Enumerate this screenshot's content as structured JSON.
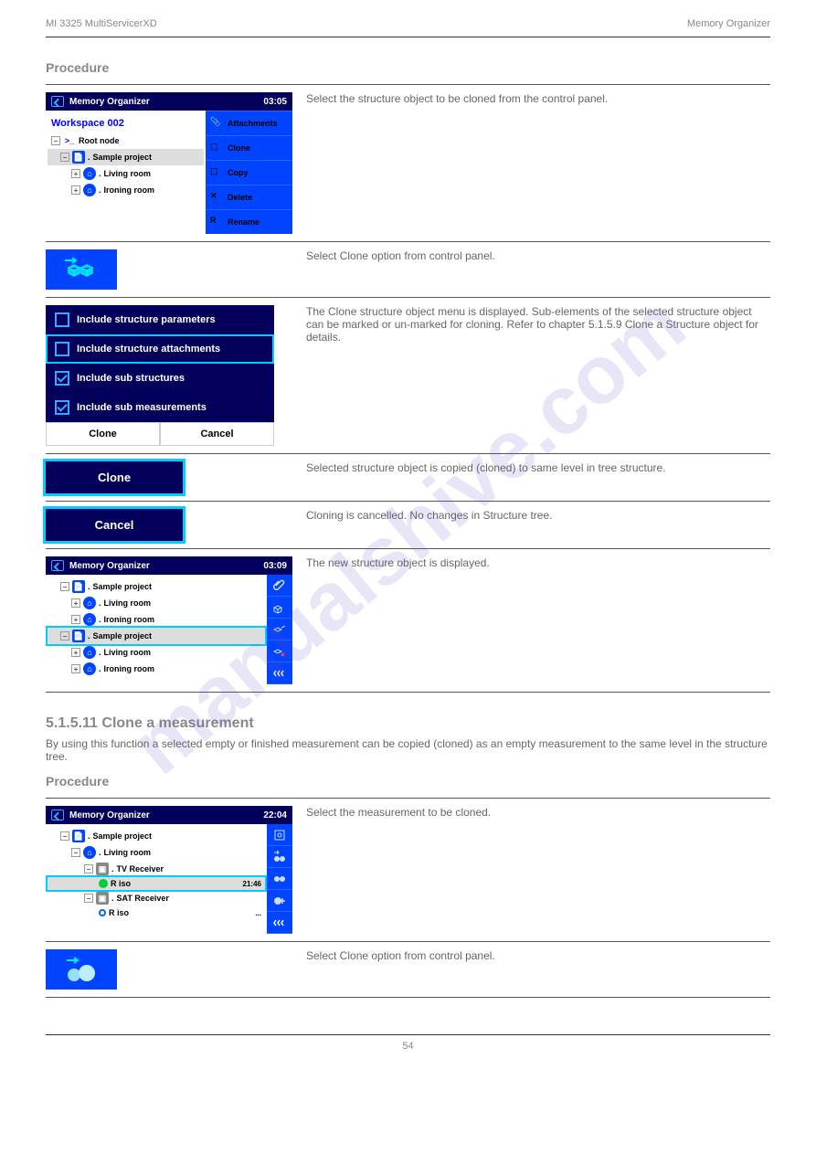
{
  "header": {
    "left": "MI 3325 MultiServicerXD",
    "right": "Memory Organizer"
  },
  "watermark": "manualshive.com",
  "proc_label": "Procedure",
  "rows": {
    "r1": {
      "screen": {
        "title": "Memory Organizer",
        "time": "03:05",
        "workspace": "Workspace 002",
        "tree": [
          "Root node",
          "Sample project",
          "Living room",
          "Ironing room"
        ],
        "menu": [
          "Attachments",
          "Clone",
          "Copy",
          "Delete",
          "Rename"
        ]
      },
      "text": "Select the structure object to be cloned from the control panel."
    },
    "r2": {
      "text": "Select Clone option from control panel."
    },
    "r3": {
      "opts": [
        "Include structure parameters",
        "Include structure attachments",
        "Include sub structures",
        "Include sub measurements"
      ],
      "btn_clone": "Clone",
      "btn_cancel": "Cancel",
      "text": "The Clone structure object menu is displayed. Sub-elements of the selected structure object can be marked or un-marked for cloning. Refer to chapter 5.1.5.9 Clone a Structure object for details."
    },
    "r4": {
      "btn": "Clone",
      "text": "Selected structure object is copied (cloned) to same level in tree structure."
    },
    "r5": {
      "btn": "Cancel",
      "text": "Cloning is cancelled. No changes in Structure tree."
    },
    "r6": {
      "screen": {
        "title": "Memory Organizer",
        "time": "03:09",
        "tree": [
          "Sample project",
          "Living room",
          "Ironing room",
          "Sample project",
          "Living room",
          "Ironing room"
        ]
      },
      "text": "The new structure object is displayed."
    }
  },
  "section": {
    "title": "5.1.5.11 Clone a measurement",
    "text": "By using this function a selected empty or finished measurement can be copied (cloned) as an empty measurement to the same level in the structure tree."
  },
  "rows2": {
    "r7": {
      "screen": {
        "title": "Memory Organizer",
        "time": "22:04",
        "tree": [
          {
            "t": "Sample project",
            "lvl": 1
          },
          {
            "t": "Living room",
            "lvl": 2
          },
          {
            "t": "TV Receiver",
            "lvl": 3
          },
          {
            "t": "R iso",
            "lvl": 4,
            "hl": true,
            "rt": "21:46",
            "dot": "g"
          },
          {
            "t": "SAT Receiver",
            "lvl": 3
          },
          {
            "t": "R iso",
            "lvl": 4,
            "rt": "...",
            "dot": "o"
          }
        ]
      },
      "text": "Select the measurement to be cloned."
    },
    "r8": {
      "text": "Select Clone option from control panel."
    }
  },
  "footer": {
    "page": "54"
  }
}
